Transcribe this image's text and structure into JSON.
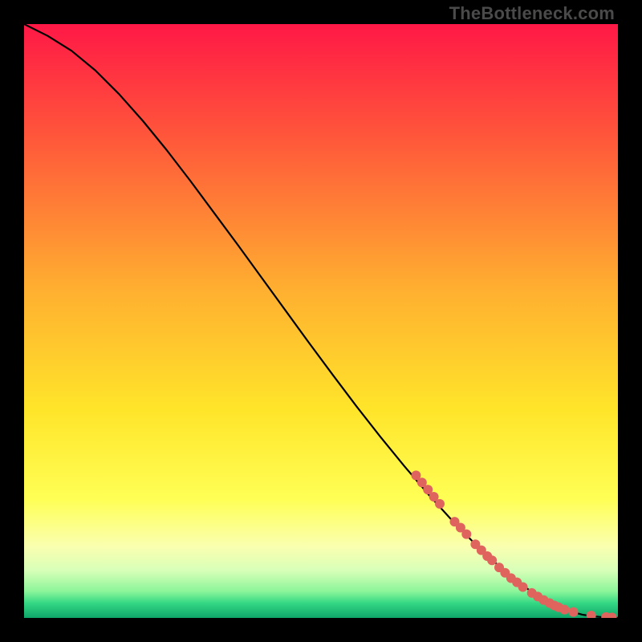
{
  "watermark": "TheBottleneck.com",
  "chart_data": {
    "type": "line",
    "title": "",
    "xlabel": "",
    "ylabel": "",
    "xlim": [
      0,
      100
    ],
    "ylim": [
      0,
      100
    ],
    "grid": false,
    "legend": false,
    "background_gradient_stops": [
      {
        "pct": 0.0,
        "color": "#ff1846"
      },
      {
        "pct": 0.2,
        "color": "#ff5a3a"
      },
      {
        "pct": 0.45,
        "color": "#ffb030"
      },
      {
        "pct": 0.65,
        "color": "#ffe52a"
      },
      {
        "pct": 0.8,
        "color": "#ffff55"
      },
      {
        "pct": 0.88,
        "color": "#faffb0"
      },
      {
        "pct": 0.92,
        "color": "#d8ffb8"
      },
      {
        "pct": 0.955,
        "color": "#8cf59a"
      },
      {
        "pct": 0.975,
        "color": "#34d884"
      },
      {
        "pct": 1.0,
        "color": "#0fa56a"
      }
    ],
    "series": [
      {
        "name": "bottleneck-curve",
        "color": "#000000",
        "x": [
          0,
          4,
          8,
          12,
          16,
          20,
          24,
          28,
          32,
          36,
          40,
          44,
          48,
          52,
          56,
          60,
          64,
          68,
          72,
          76,
          80,
          83,
          86,
          88,
          90,
          92,
          94,
          96,
          98,
          100
        ],
        "y": [
          100,
          98,
          95.5,
          92.2,
          88.2,
          83.7,
          78.8,
          73.6,
          68.2,
          62.8,
          57.3,
          51.8,
          46.3,
          40.9,
          35.6,
          30.5,
          25.6,
          20.9,
          16.5,
          12.4,
          8.7,
          6.2,
          4.0,
          2.8,
          1.8,
          1.1,
          0.55,
          0.25,
          0.08,
          0.02
        ]
      }
    ],
    "markers": {
      "name": "sample-points",
      "color": "#e0645e",
      "radius_px": 6,
      "points": [
        {
          "x": 66,
          "y": 24.0
        },
        {
          "x": 67,
          "y": 22.8
        },
        {
          "x": 68,
          "y": 21.6
        },
        {
          "x": 69,
          "y": 20.4
        },
        {
          "x": 70,
          "y": 19.2
        },
        {
          "x": 72.5,
          "y": 16.2
        },
        {
          "x": 73.5,
          "y": 15.2
        },
        {
          "x": 74.5,
          "y": 14.1
        },
        {
          "x": 76,
          "y": 12.4
        },
        {
          "x": 77,
          "y": 11.4
        },
        {
          "x": 78,
          "y": 10.4
        },
        {
          "x": 78.8,
          "y": 9.7
        },
        {
          "x": 80,
          "y": 8.5
        },
        {
          "x": 81,
          "y": 7.6
        },
        {
          "x": 82,
          "y": 6.7
        },
        {
          "x": 83,
          "y": 6.0
        },
        {
          "x": 84,
          "y": 5.2
        },
        {
          "x": 85.5,
          "y": 4.2
        },
        {
          "x": 86.5,
          "y": 3.6
        },
        {
          "x": 87.5,
          "y": 3.0
        },
        {
          "x": 88.5,
          "y": 2.5
        },
        {
          "x": 89.3,
          "y": 2.1
        },
        {
          "x": 90,
          "y": 1.8
        },
        {
          "x": 91,
          "y": 1.4
        },
        {
          "x": 92.5,
          "y": 1.0
        },
        {
          "x": 95.5,
          "y": 0.4
        },
        {
          "x": 98,
          "y": 0.15
        },
        {
          "x": 99,
          "y": 0.08
        }
      ]
    }
  }
}
